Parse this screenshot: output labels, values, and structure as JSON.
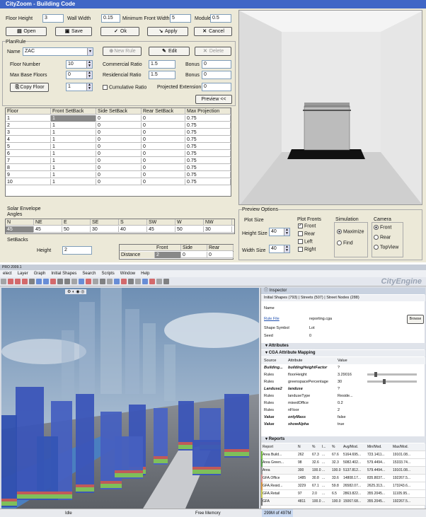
{
  "title": "CityZoom - Building Code",
  "top": {
    "floor_height_label": "Floor Height",
    "floor_height": "3",
    "wall_width_label": "Wall Width",
    "wall_width": "0.15",
    "min_front_width_label": "Minimum Front Width",
    "min_front_width": "5",
    "module_label": "Module",
    "module": "0.5"
  },
  "buttons": {
    "open": "Open",
    "save": "Save",
    "ok": "Ok",
    "apply": "Apply",
    "cancel": "Cancel",
    "new_rule": "New Rule",
    "edit": "Edit",
    "delete": "Delete",
    "copy_floor": "Copy Floor",
    "preview": "Preview <<"
  },
  "planrule": {
    "legend": "PlanRule",
    "name_label": "Name",
    "name_value": "ZAC",
    "floor_number_label": "Floor Number",
    "floor_number": "10",
    "commercial_ratio_label": "Commercial Ratio",
    "commercial_ratio": "1.5",
    "bonus_label": "Bonus",
    "bonus1": "0",
    "max_base_floors_label": "Max Base Floors",
    "max_base_floors": "0",
    "residencial_ratio_label": "Residencial Ratio",
    "residencial_ratio": "1.5",
    "bonus2": "0",
    "copy_floor_value": "1",
    "cumulative_label": "Cumulative Ratio",
    "projected_ext_label": "Projected Extension",
    "projected_ext": "0"
  },
  "floor_table": {
    "headers": [
      "Floor",
      "Front SetBack",
      "Side SetBack",
      "Rear SetBack",
      "Max Projection"
    ],
    "rows": [
      [
        "1",
        "1",
        "0",
        "0",
        "0.75"
      ],
      [
        "2",
        "1",
        "0",
        "0",
        "0.75"
      ],
      [
        "3",
        "1",
        "0",
        "0",
        "0.75"
      ],
      [
        "4",
        "1",
        "0",
        "0",
        "0.75"
      ],
      [
        "5",
        "1",
        "0",
        "0",
        "0.75"
      ],
      [
        "6",
        "1",
        "0",
        "0",
        "0.75"
      ],
      [
        "7",
        "1",
        "0",
        "0",
        "0.75"
      ],
      [
        "8",
        "1",
        "0",
        "0",
        "0.75"
      ],
      [
        "9",
        "1",
        "0",
        "0",
        "0.75"
      ],
      [
        "10",
        "1",
        "0",
        "0",
        "0.75"
      ]
    ]
  },
  "solar": {
    "legend": "Solar Envelope",
    "angles_label": "Angles",
    "headers": [
      "N",
      "NE",
      "E",
      "SE",
      "S",
      "SW",
      "W",
      "NW"
    ],
    "values": [
      "45",
      "45",
      "50",
      "30",
      "40",
      "45",
      "50",
      "30"
    ],
    "setbacks_label": "SetBacks",
    "height_label": "Height",
    "height": "2",
    "cols": [
      "Front",
      "Side",
      "Rear"
    ],
    "distance_label": "Distance",
    "distance": [
      "2",
      "0",
      "0"
    ]
  },
  "preview": {
    "legend": "Preview Options",
    "plot_size_label": "Plot Size",
    "height_size_label": "Height Size",
    "height_size": "40",
    "width_size_label": "Width Size",
    "width_size": "40",
    "plot_fronts_label": "Plot Fronts",
    "fronts": [
      "Front",
      "Rear",
      "Left",
      "Right"
    ],
    "simulation_label": "Simulation",
    "sim_options": [
      "Maximize",
      "Find"
    ],
    "camera_label": "Camera",
    "camera_options": [
      "Front",
      "Rear",
      "TopView"
    ]
  },
  "ce": {
    "title": "PRO 2009.1",
    "menus": [
      "elect",
      "Layer",
      "Graph",
      "Initial Shapes",
      "Search",
      "Scripts",
      "Window",
      "Help"
    ],
    "brand": "CityEngine",
    "inspector_tab": "Inspector",
    "subtabs": [
      "Initial Shapes (793)",
      "Streets (507)",
      "Street Nodes (288)"
    ],
    "name_label": "Name",
    "rule_file_label": "Rule File",
    "rule_file": "reporting.cga",
    "browse": "Browse",
    "shape_symbol_label": "Shape Symbol",
    "shape_symbol": "Lot",
    "seed_label": "Seed",
    "seed": "0",
    "attributes_label": "Attributes",
    "cga_label": "CGA Attribute Mapping",
    "attr_headers": [
      "Source",
      "Attribute",
      "Value"
    ],
    "attrs": [
      [
        "Building...",
        "buildingHeightFactor",
        "?"
      ],
      [
        "Rules",
        "floorHeight",
        "3.29016"
      ],
      [
        "Rules",
        "greenspacePercentage",
        "30"
      ],
      [
        "Landuse2",
        "landuse",
        "?"
      ],
      [
        "Rules",
        "landuseType",
        "Reside..."
      ],
      [
        "Rules",
        "mixedOffice",
        "0.2"
      ],
      [
        "Rules",
        "nFloor",
        "2"
      ],
      [
        "Value",
        "onlyMass",
        "false"
      ],
      [
        "Value",
        "showAlpha",
        "true"
      ]
    ],
    "reports_label": "Reports",
    "rep_headers": [
      "Report",
      "N",
      "%",
      "I...",
      "%",
      "Avg/Mod.",
      "Min/Mod.",
      "Max/Mod."
    ],
    "reports": [
      [
        "Area Build...",
        "262",
        "67.3",
        "...",
        "67.6",
        "5164.695...",
        "723.1411...",
        "19101.08..."
      ],
      [
        "Area Green...",
        "98",
        "32.6",
        "...",
        "32.3",
        "5082.402...",
        "579.4494...",
        "15333.74..."
      ],
      [
        "Area",
        "300",
        "100.0",
        "...",
        "100.0",
        "5137.812...",
        "579.4494...",
        "19101.08..."
      ],
      [
        "GFA.Office",
        "1485",
        "30.8",
        "...",
        "33.6",
        "14808.17...",
        "835.8037...",
        "192267.5..."
      ],
      [
        "GFA.Resid...",
        "3229",
        "67.1",
        "...",
        "59.8",
        "26582.07...",
        "2625.313...",
        "173243.6..."
      ],
      [
        "GFA.Retail",
        "97",
        "2.0",
        "...",
        "6.5",
        "2863.822...",
        "355.2045...",
        "11105.95..."
      ],
      [
        "GFA",
        "4811",
        "100.0",
        "...",
        "100.0",
        "15067.68...",
        "355.2045...",
        "192267.5..."
      ]
    ],
    "status_idle": "Idle",
    "status_mem": "Free Memory",
    "status_used": "299M of 497M"
  },
  "colors": {
    "titlebar": "#3f66c6",
    "sky": "#8fa9c4",
    "building": "#3b55b8"
  }
}
